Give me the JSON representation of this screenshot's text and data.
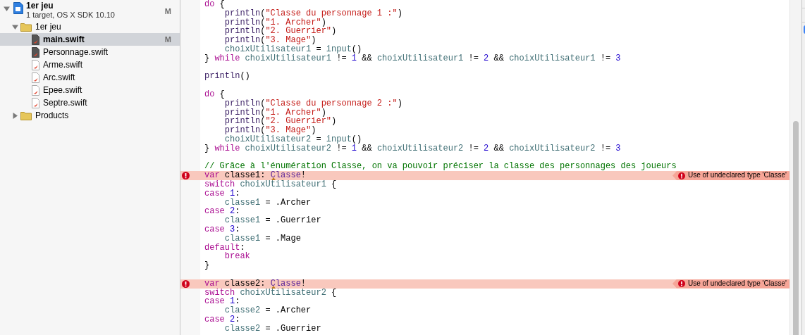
{
  "navigator": {
    "project": {
      "title": "1er jeu",
      "subtitle": "1 target, OS X SDK 10.10",
      "badge": "M",
      "expanded": true,
      "children": [
        {
          "kind": "folder",
          "name": "1er jeu",
          "expanded": true,
          "children": [
            {
              "kind": "file-dark",
              "name": "main.swift",
              "selected": true,
              "badge": "M"
            },
            {
              "kind": "file-dark",
              "name": "Personnage.swift",
              "selected": false
            },
            {
              "kind": "file",
              "name": "Arme.swift",
              "selected": false
            },
            {
              "kind": "file",
              "name": "Arc.swift",
              "selected": false
            },
            {
              "kind": "file",
              "name": "Epee.swift",
              "selected": false
            },
            {
              "kind": "file",
              "name": "Septre.swift",
              "selected": false
            }
          ]
        },
        {
          "kind": "folder",
          "name": "Products",
          "expanded": false
        }
      ]
    }
  },
  "editor": {
    "lines": [
      {
        "kind": "code",
        "indented": false,
        "tokens": [
          {
            "kind": "keyword",
            "text": "do"
          },
          {
            "kind": "plain",
            "text": " {"
          }
        ]
      },
      {
        "kind": "code",
        "indented": true,
        "tokens": [
          {
            "kind": "function",
            "text": "println"
          },
          {
            "kind": "plain",
            "text": "("
          },
          {
            "kind": "string",
            "text": "\"Classe du personnage 1 :\""
          },
          {
            "kind": "plain",
            "text": ")"
          }
        ]
      },
      {
        "kind": "code",
        "indented": true,
        "tokens": [
          {
            "kind": "function",
            "text": "println"
          },
          {
            "kind": "plain",
            "text": "("
          },
          {
            "kind": "string",
            "text": "\"1. Archer\""
          },
          {
            "kind": "plain",
            "text": ")"
          }
        ]
      },
      {
        "kind": "code",
        "indented": true,
        "tokens": [
          {
            "kind": "function",
            "text": "println"
          },
          {
            "kind": "plain",
            "text": "("
          },
          {
            "kind": "string",
            "text": "\"2. Guerrier\""
          },
          {
            "kind": "plain",
            "text": ")"
          }
        ]
      },
      {
        "kind": "code",
        "indented": true,
        "tokens": [
          {
            "kind": "function",
            "text": "println"
          },
          {
            "kind": "plain",
            "text": "("
          },
          {
            "kind": "string",
            "text": "\"3. Mage\""
          },
          {
            "kind": "plain",
            "text": ")"
          }
        ]
      },
      {
        "kind": "code",
        "indented": true,
        "tokens": [
          {
            "kind": "identifier",
            "text": "choixUtilisateur1"
          },
          {
            "kind": "plain",
            "text": " = "
          },
          {
            "kind": "identifier",
            "text": "input"
          },
          {
            "kind": "plain",
            "text": "()"
          }
        ]
      },
      {
        "kind": "code",
        "indented": false,
        "tokens": [
          {
            "kind": "plain",
            "text": "} "
          },
          {
            "kind": "keyword",
            "text": "while"
          },
          {
            "kind": "identifier",
            "text": " choixUtilisateur1"
          },
          {
            "kind": "plain",
            "text": " != "
          },
          {
            "kind": "number",
            "text": "1"
          },
          {
            "kind": "plain",
            "text": " && "
          },
          {
            "kind": "identifier",
            "text": "choixUtilisateur1"
          },
          {
            "kind": "plain",
            "text": " != "
          },
          {
            "kind": "number",
            "text": "2"
          },
          {
            "kind": "plain",
            "text": " && "
          },
          {
            "kind": "identifier",
            "text": "choixUtilisateur1"
          },
          {
            "kind": "plain",
            "text": " != "
          },
          {
            "kind": "number",
            "text": "3"
          }
        ]
      },
      {
        "kind": "blank"
      },
      {
        "kind": "code",
        "indented": false,
        "tokens": [
          {
            "kind": "function",
            "text": "println"
          },
          {
            "kind": "plain",
            "text": "()"
          }
        ]
      },
      {
        "kind": "blank"
      },
      {
        "kind": "code",
        "indented": false,
        "tokens": [
          {
            "kind": "keyword",
            "text": "do"
          },
          {
            "kind": "plain",
            "text": " {"
          }
        ]
      },
      {
        "kind": "code",
        "indented": true,
        "tokens": [
          {
            "kind": "function",
            "text": "println"
          },
          {
            "kind": "plain",
            "text": "("
          },
          {
            "kind": "string",
            "text": "\"Classe du personnage 2 :\""
          },
          {
            "kind": "plain",
            "text": ")"
          }
        ]
      },
      {
        "kind": "code",
        "indented": true,
        "tokens": [
          {
            "kind": "function",
            "text": "println"
          },
          {
            "kind": "plain",
            "text": "("
          },
          {
            "kind": "string",
            "text": "\"1. Archer\""
          },
          {
            "kind": "plain",
            "text": ")"
          }
        ]
      },
      {
        "kind": "code",
        "indented": true,
        "tokens": [
          {
            "kind": "function",
            "text": "println"
          },
          {
            "kind": "plain",
            "text": "("
          },
          {
            "kind": "string",
            "text": "\"2. Guerrier\""
          },
          {
            "kind": "plain",
            "text": ")"
          }
        ]
      },
      {
        "kind": "code",
        "indented": true,
        "tokens": [
          {
            "kind": "function",
            "text": "println"
          },
          {
            "kind": "plain",
            "text": "("
          },
          {
            "kind": "string",
            "text": "\"3. Mage\""
          },
          {
            "kind": "plain",
            "text": ")"
          }
        ]
      },
      {
        "kind": "code",
        "indented": true,
        "tokens": [
          {
            "kind": "identifier",
            "text": "choixUtilisateur2"
          },
          {
            "kind": "plain",
            "text": " = "
          },
          {
            "kind": "identifier",
            "text": "input"
          },
          {
            "kind": "plain",
            "text": "()"
          }
        ]
      },
      {
        "kind": "code",
        "indented": false,
        "tokens": [
          {
            "kind": "plain",
            "text": "} "
          },
          {
            "kind": "keyword",
            "text": "while"
          },
          {
            "kind": "identifier",
            "text": " choixUtilisateur2"
          },
          {
            "kind": "plain",
            "text": " != "
          },
          {
            "kind": "number",
            "text": "1"
          },
          {
            "kind": "plain",
            "text": " && "
          },
          {
            "kind": "identifier",
            "text": "choixUtilisateur2"
          },
          {
            "kind": "plain",
            "text": " != "
          },
          {
            "kind": "number",
            "text": "2"
          },
          {
            "kind": "plain",
            "text": " && "
          },
          {
            "kind": "identifier",
            "text": "choixUtilisateur2"
          },
          {
            "kind": "plain",
            "text": " != "
          },
          {
            "kind": "number",
            "text": "3"
          }
        ]
      },
      {
        "kind": "blank"
      },
      {
        "kind": "code",
        "indented": false,
        "tokens": [
          {
            "kind": "comment",
            "text": "// Grâce à l'énumération Classe, on va pouvoir préciser la classe des personnages des joueurs"
          }
        ]
      },
      {
        "kind": "code",
        "indented": false,
        "tokens": [
          {
            "kind": "keyword",
            "text": "var"
          },
          {
            "kind": "plain",
            "text": " classe1: "
          },
          {
            "kind": "error-type",
            "text": "Classe"
          },
          {
            "kind": "plain",
            "text": "!"
          }
        ],
        "error": "Use of undeclared type 'Classe'"
      },
      {
        "kind": "code",
        "indented": false,
        "tokens": [
          {
            "kind": "keyword",
            "text": "switch"
          },
          {
            "kind": "identifier",
            "text": " choixUtilisateur1"
          },
          {
            "kind": "plain",
            "text": " {"
          }
        ]
      },
      {
        "kind": "code",
        "indented": false,
        "tokens": [
          {
            "kind": "keyword",
            "text": "case"
          },
          {
            "kind": "number",
            "text": " 1"
          },
          {
            "kind": "plain",
            "text": ":"
          }
        ]
      },
      {
        "kind": "code",
        "indented": true,
        "tokens": [
          {
            "kind": "identifier",
            "text": "classe1"
          },
          {
            "kind": "plain",
            "text": " = .Archer"
          }
        ]
      },
      {
        "kind": "code",
        "indented": false,
        "tokens": [
          {
            "kind": "keyword",
            "text": "case"
          },
          {
            "kind": "number",
            "text": " 2"
          },
          {
            "kind": "plain",
            "text": ":"
          }
        ]
      },
      {
        "kind": "code",
        "indented": true,
        "tokens": [
          {
            "kind": "identifier",
            "text": "classe1"
          },
          {
            "kind": "plain",
            "text": " = .Guerrier"
          }
        ]
      },
      {
        "kind": "code",
        "indented": false,
        "tokens": [
          {
            "kind": "keyword",
            "text": "case"
          },
          {
            "kind": "number",
            "text": " 3"
          },
          {
            "kind": "plain",
            "text": ":"
          }
        ]
      },
      {
        "kind": "code",
        "indented": true,
        "tokens": [
          {
            "kind": "identifier",
            "text": "classe1"
          },
          {
            "kind": "plain",
            "text": " = .Mage"
          }
        ]
      },
      {
        "kind": "code",
        "indented": false,
        "tokens": [
          {
            "kind": "keyword",
            "text": "default"
          },
          {
            "kind": "plain",
            "text": ":"
          }
        ]
      },
      {
        "kind": "code",
        "indented": true,
        "tokens": [
          {
            "kind": "keyword",
            "text": "break"
          }
        ]
      },
      {
        "kind": "code",
        "indented": false,
        "tokens": [
          {
            "kind": "plain",
            "text": "}"
          }
        ]
      },
      {
        "kind": "blank"
      },
      {
        "kind": "code",
        "indented": false,
        "tokens": [
          {
            "kind": "keyword",
            "text": "var"
          },
          {
            "kind": "plain",
            "text": " classe2: "
          },
          {
            "kind": "error-type",
            "text": "Classe"
          },
          {
            "kind": "plain",
            "text": "!"
          }
        ],
        "error": "Use of undeclared type 'Classe'"
      },
      {
        "kind": "code",
        "indented": false,
        "tokens": [
          {
            "kind": "keyword",
            "text": "switch"
          },
          {
            "kind": "identifier",
            "text": " choixUtilisateur2"
          },
          {
            "kind": "plain",
            "text": " {"
          }
        ]
      },
      {
        "kind": "code",
        "indented": false,
        "tokens": [
          {
            "kind": "keyword",
            "text": "case"
          },
          {
            "kind": "number",
            "text": " 1"
          },
          {
            "kind": "plain",
            "text": ":"
          }
        ]
      },
      {
        "kind": "code",
        "indented": true,
        "tokens": [
          {
            "kind": "identifier",
            "text": "classe2"
          },
          {
            "kind": "plain",
            "text": " = .Archer"
          }
        ]
      },
      {
        "kind": "code",
        "indented": false,
        "tokens": [
          {
            "kind": "keyword",
            "text": "case"
          },
          {
            "kind": "number",
            "text": " 2"
          },
          {
            "kind": "plain",
            "text": ":"
          }
        ]
      },
      {
        "kind": "code",
        "indented": true,
        "tokens": [
          {
            "kind": "identifier",
            "text": "classe2"
          },
          {
            "kind": "plain",
            "text": " = .Guerrier"
          }
        ]
      }
    ]
  }
}
